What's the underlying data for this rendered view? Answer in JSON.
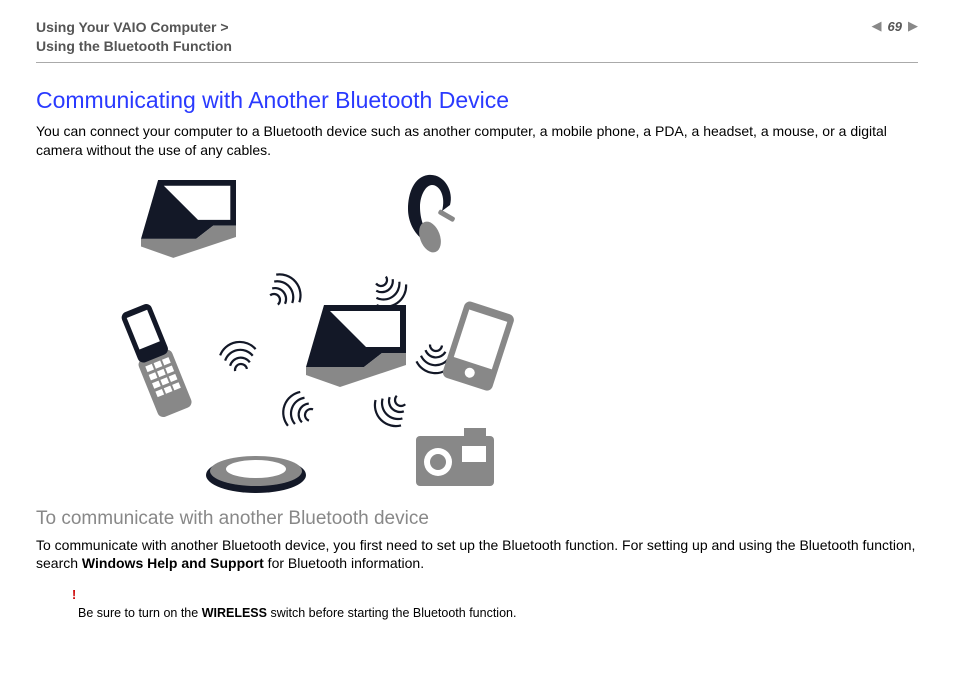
{
  "header": {
    "breadcrumb_line1": "Using Your VAIO Computer >",
    "breadcrumb_line2": "Using the Bluetooth Function",
    "page_number": "69"
  },
  "content": {
    "title": "Communicating with Another Bluetooth Device",
    "intro": "You can connect your computer to a Bluetooth device such as another computer, a mobile phone, a PDA, a headset, a mouse, or a digital camera without the use of any cables.",
    "subheading": "To communicate with another Bluetooth device",
    "para2_part1": "To communicate with another Bluetooth device, you first need to set up the Bluetooth function. For setting up and using the Bluetooth function, search ",
    "para2_bold": "Windows Help and Support",
    "para2_part2": " for Bluetooth information.",
    "note_bang": "!",
    "note_part1": "Be sure to turn on the ",
    "note_bold": "WIRELESS",
    "note_part2": " switch before starting the Bluetooth function."
  },
  "diagram": {
    "devices": [
      "laptop",
      "headset",
      "pda",
      "camera",
      "mouse",
      "flip-phone",
      "laptop-center"
    ]
  }
}
